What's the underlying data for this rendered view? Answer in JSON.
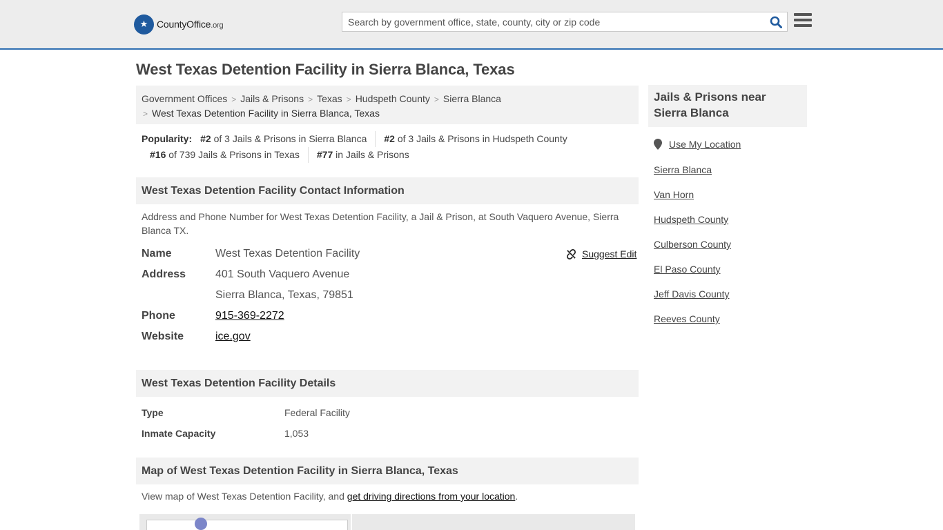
{
  "header": {
    "logo_text": "CountyOffice",
    "logo_tld": ".org",
    "search_placeholder": "Search by government office, state, county, city or zip code"
  },
  "page_title": "West Texas Detention Facility in Sierra Blanca, Texas",
  "breadcrumb": [
    "Government Offices",
    "Jails & Prisons",
    "Texas",
    "Hudspeth County",
    "Sierra Blanca",
    "West Texas Detention Facility in Sierra Blanca, Texas"
  ],
  "popularity": {
    "label": "Popularity:",
    "items": [
      {
        "rank": "#2",
        "text": "of 3 Jails & Prisons in Sierra Blanca"
      },
      {
        "rank": "#2",
        "text": "of 3 Jails & Prisons in Hudspeth County"
      },
      {
        "rank": "#16",
        "text": "of 739 Jails & Prisons in Texas"
      },
      {
        "rank": "#77",
        "text": "in Jails & Prisons"
      }
    ]
  },
  "contact": {
    "heading": "West Texas Detention Facility Contact Information",
    "description": "Address and Phone Number for West Texas Detention Facility, a Jail & Prison, at South Vaquero Avenue, Sierra Blanca TX.",
    "suggest_edit": "Suggest Edit",
    "name_label": "Name",
    "name_value": "West Texas Detention Facility",
    "address_label": "Address",
    "address_line1": "401 South Vaquero Avenue",
    "address_line2": "Sierra Blanca, Texas, 79851",
    "phone_label": "Phone",
    "phone_value": "915-369-2272",
    "website_label": "Website",
    "website_value": "ice.gov"
  },
  "details": {
    "heading": "West Texas Detention Facility Details",
    "type_label": "Type",
    "type_value": "Federal Facility",
    "capacity_label": "Inmate Capacity",
    "capacity_value": "1,053"
  },
  "map": {
    "heading": "Map of West Texas Detention Facility in Sierra Blanca, Texas",
    "description_prefix": "View map of West Texas Detention Facility, and",
    "directions_link": "get driving directions from your location",
    "description_suffix": "."
  },
  "sidebar": {
    "heading": "Jails & Prisons near Sierra Blanca",
    "use_location": "Use My Location",
    "links": [
      "Sierra Blanca",
      "Van Horn",
      "Hudspeth County",
      "Culberson County",
      "El Paso County",
      "Jeff Davis County",
      "Reeves County"
    ]
  }
}
